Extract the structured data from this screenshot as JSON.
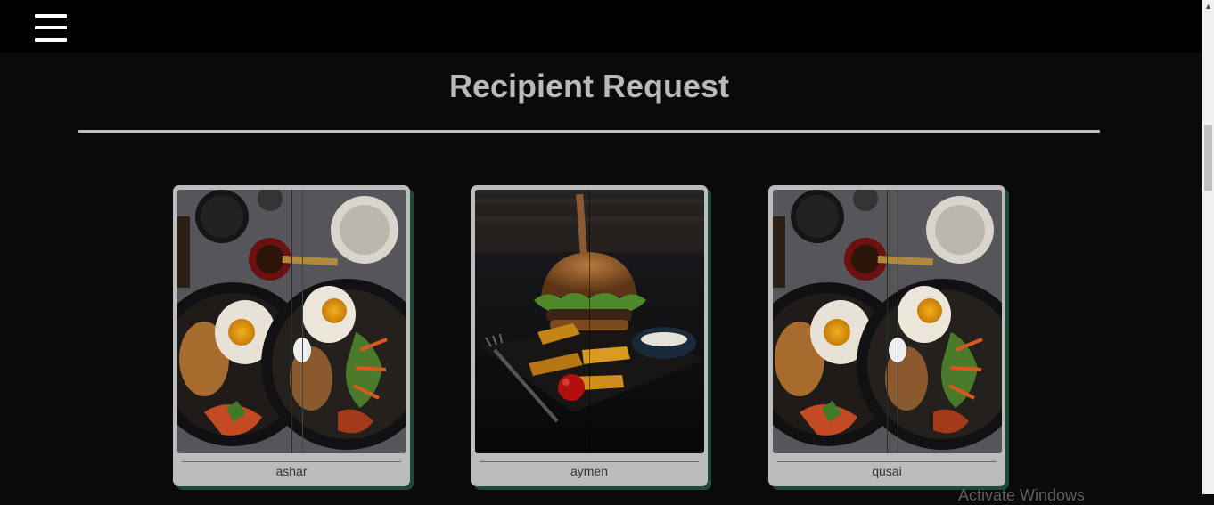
{
  "page": {
    "title": "Recipient Request"
  },
  "menu": {
    "icon": "hamburger-menu-icon"
  },
  "cards": [
    {
      "name": "ashar",
      "image": "breakfast-plates-photo"
    },
    {
      "name": "aymen",
      "image": "burger-and-fries-photo"
    },
    {
      "name": "qusai",
      "image": "breakfast-plates-photo"
    }
  ],
  "watermark": "Activate Windows",
  "colors": {
    "background": "#0a0a0a",
    "topbar": "#000000",
    "title": "#b9b9b9",
    "card": "#bcbcbc",
    "card_shadow": "#1c4a36"
  }
}
